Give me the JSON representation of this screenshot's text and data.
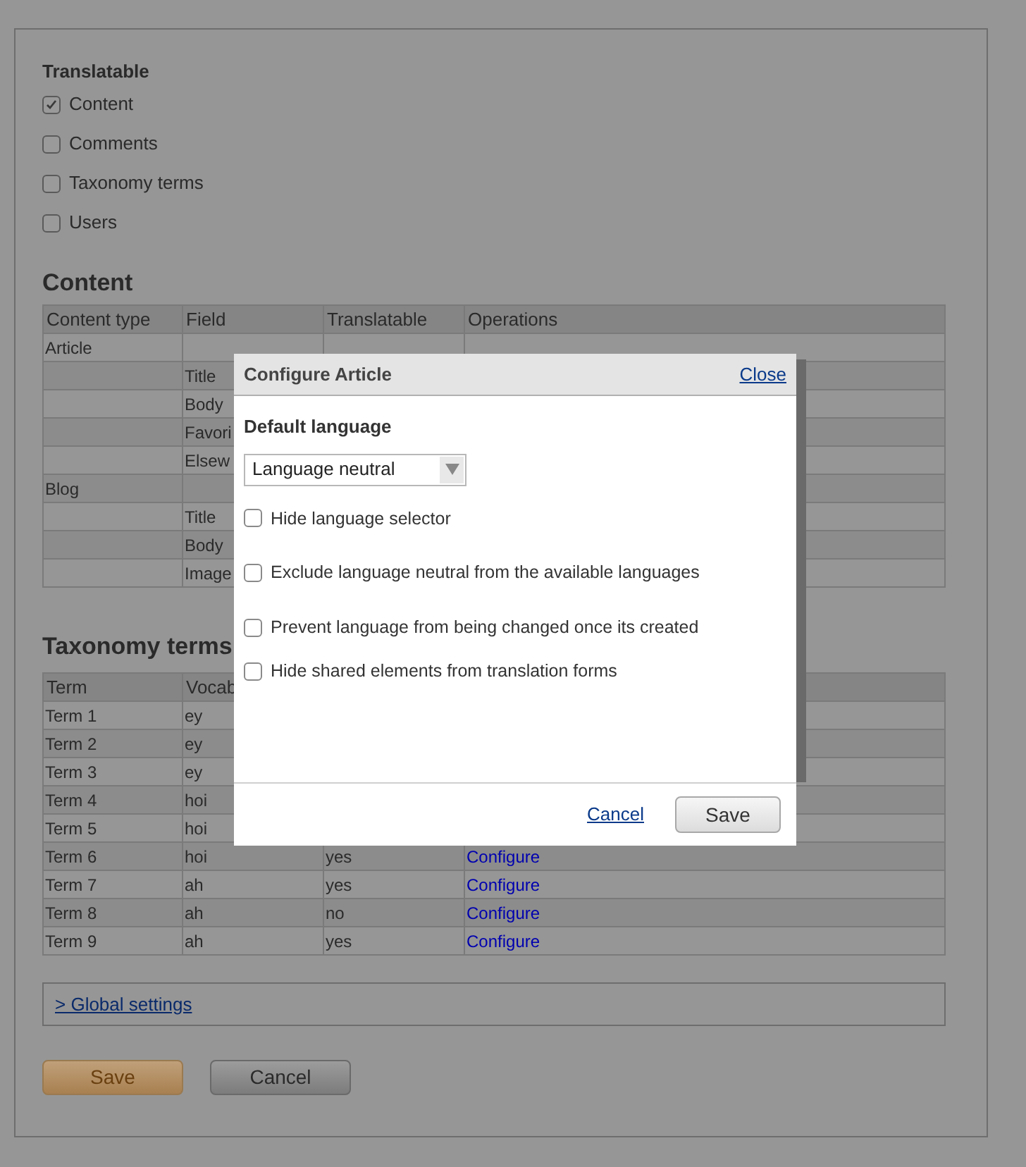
{
  "translatable": {
    "heading": "Translatable",
    "options": [
      {
        "label": "Content",
        "checked": true
      },
      {
        "label": "Comments",
        "checked": false
      },
      {
        "label": "Taxonomy terms",
        "checked": false
      },
      {
        "label": "Users",
        "checked": false
      }
    ]
  },
  "content": {
    "heading": "Content",
    "columns": [
      "Content type",
      "Field",
      "Translatable",
      "Operations"
    ],
    "rows": [
      {
        "content_type": "Article"
      },
      {
        "field": "Title"
      },
      {
        "field": "Body"
      },
      {
        "field": "Favori"
      },
      {
        "field": "Elsew"
      },
      {
        "content_type": "Blog"
      },
      {
        "field": "Title"
      },
      {
        "field": "Body"
      },
      {
        "field": "Image"
      }
    ]
  },
  "taxonomy": {
    "heading": "Taxonomy terms",
    "columns": [
      "Term",
      "Vocab"
    ],
    "rows": [
      {
        "term": "Term 1",
        "vocabulary": "ey"
      },
      {
        "term": "Term 2",
        "vocabulary": "ey"
      },
      {
        "term": "Term 3",
        "vocabulary": "ey"
      },
      {
        "term": "Term 4",
        "vocabulary": "hoi"
      },
      {
        "term": "Term 5",
        "vocabulary": "hoi"
      },
      {
        "term": "Term 6",
        "vocabulary": "hoi",
        "translatable": "yes",
        "operation": "Configure"
      },
      {
        "term": "Term 7",
        "vocabulary": "ah",
        "translatable": "yes",
        "operation": "Configure"
      },
      {
        "term": "Term 8",
        "vocabulary": "ah",
        "translatable": "no",
        "operation": "Configure"
      },
      {
        "term": "Term 9",
        "vocabulary": "ah",
        "translatable": "yes",
        "operation": "Configure"
      }
    ]
  },
  "global_settings": {
    "link": "> Global settings"
  },
  "buttons": [
    {
      "label": "Save",
      "kind": "primary"
    },
    {
      "label": "Cancel",
      "kind": "secondary"
    }
  ],
  "dialog": {
    "title": "Configure Article",
    "close": "Close",
    "field_label": "Default language",
    "select_value": "Language neutral",
    "options": [
      {
        "label": "Hide language selector",
        "checked": false
      },
      {
        "label": "Exclude language neutral from the available languages",
        "checked": false
      },
      {
        "label": "Prevent language from being changed once its created",
        "checked": false
      },
      {
        "label": "Hide shared elements from translation forms",
        "checked": false
      }
    ],
    "cancel": "Cancel",
    "save": "Save"
  }
}
